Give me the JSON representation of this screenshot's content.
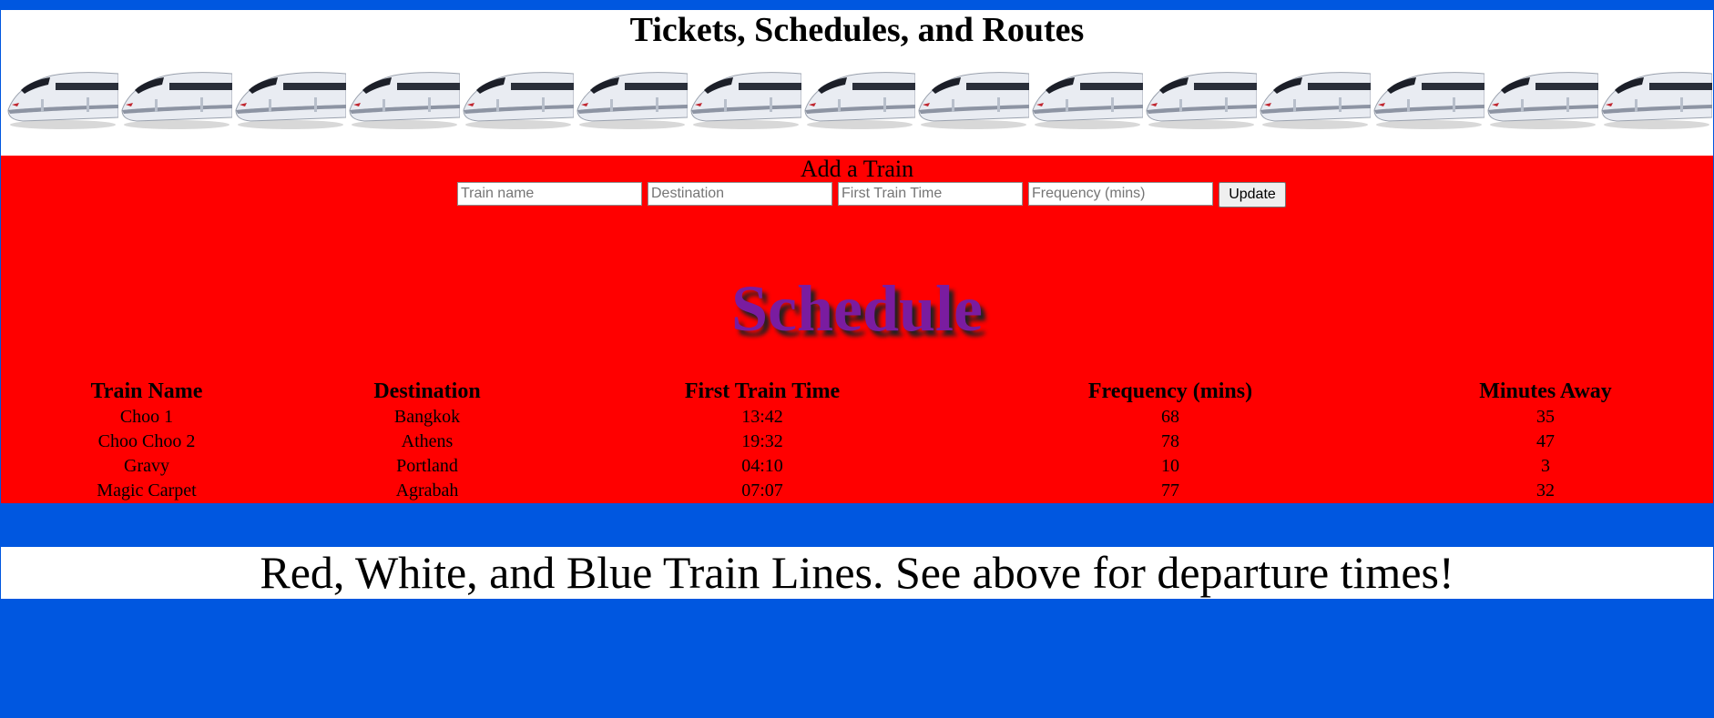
{
  "header": {
    "title": "Tickets, Schedules, and Routes",
    "train_image_count": 15
  },
  "form": {
    "title": "Add a Train",
    "fields": {
      "train_name_placeholder": "Train name",
      "destination_placeholder": "Destination",
      "first_time_placeholder": "First Train Time",
      "frequency_placeholder": "Frequency (mins)"
    },
    "submit_label": "Update"
  },
  "schedule": {
    "heading": "Schedule",
    "columns": [
      "Train Name",
      "Destination",
      "First Train Time",
      "Frequency (mins)",
      "Minutes Away"
    ],
    "rows": [
      [
        "Choo 1",
        "Bangkok",
        "13:42",
        "68",
        "35"
      ],
      [
        "Choo Choo 2",
        "Athens",
        "19:32",
        "78",
        "47"
      ],
      [
        "Gravy",
        "Portland",
        "04:10",
        "10",
        "3"
      ],
      [
        "Magic Carpet",
        "Agrabah",
        "07:07",
        "77",
        "32"
      ]
    ]
  },
  "footer": {
    "text": "Red, White, and Blue Train Lines. See above for departure times!"
  },
  "colors": {
    "page_background": "#0057e0",
    "panel_red": "#ff0000",
    "schedule_heading": "#7a1ca0"
  }
}
